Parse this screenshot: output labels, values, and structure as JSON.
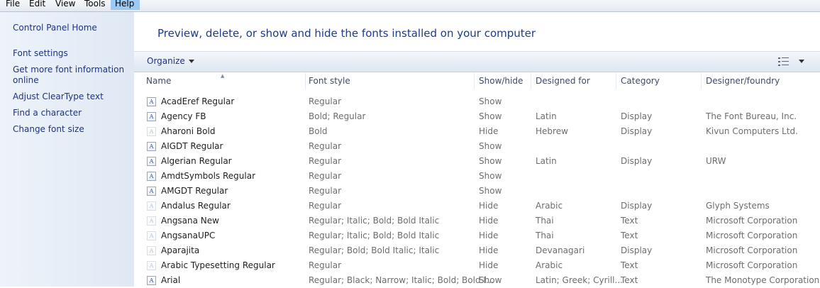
{
  "menu": [
    "File",
    "Edit",
    "View",
    "Tools",
    "Help"
  ],
  "sidebar": {
    "home": "Control Panel Home",
    "links": [
      "Font settings",
      "Get more font information online",
      "Adjust ClearType text",
      "Find a character",
      "Change font size"
    ]
  },
  "heading": "Preview, delete, or show and hide the fonts installed on your computer",
  "toolbar": {
    "organize": "Organize"
  },
  "columns": [
    "Name",
    "Font style",
    "Show/hide",
    "Designed for",
    "Category",
    "Designer/foundry"
  ],
  "rows": [
    [
      "AcadEref Regular",
      "Regular",
      "Show",
      "",
      "",
      ""
    ],
    [
      "Agency FB",
      "Bold; Regular",
      "Show",
      "Latin",
      "Display",
      "The Font Bureau, Inc."
    ],
    [
      "Aharoni Bold",
      "Bold",
      "Hide",
      "Hebrew",
      "Display",
      "Kivun Computers Ltd."
    ],
    [
      "AIGDT Regular",
      "Regular",
      "Show",
      "",
      "",
      ""
    ],
    [
      "Algerian Regular",
      "Regular",
      "Show",
      "Latin",
      "Display",
      "URW"
    ],
    [
      "AmdtSymbols Regular",
      "Regular",
      "Show",
      "",
      "",
      ""
    ],
    [
      "AMGDT Regular",
      "Regular",
      "Show",
      "",
      "",
      ""
    ],
    [
      "Andalus Regular",
      "Regular",
      "Hide",
      "Arabic",
      "Display",
      "Glyph Systems"
    ],
    [
      "Angsana New",
      "Regular; Italic; Bold; Bold Italic",
      "Hide",
      "Thai",
      "Text",
      "Microsoft Corporation"
    ],
    [
      "AngsanaUPC",
      "Regular; Italic; Bold; Bold Italic",
      "Hide",
      "Thai",
      "Text",
      "Microsoft Corporation"
    ],
    [
      "Aparajita",
      "Regular; Bold; Bold Italic; Italic",
      "Hide",
      "Devanagari",
      "Display",
      "Microsoft Corporation"
    ],
    [
      "Arabic Typesetting Regular",
      "Regular",
      "Hide",
      "Arabic",
      "Text",
      "Microsoft Corporation"
    ],
    [
      "Arial",
      "Regular; Black; Narrow; Italic; Bold; Bold I...",
      "Show",
      "Latin; Greek; Cyrill...",
      "Text",
      "The Monotype Corporation"
    ]
  ]
}
